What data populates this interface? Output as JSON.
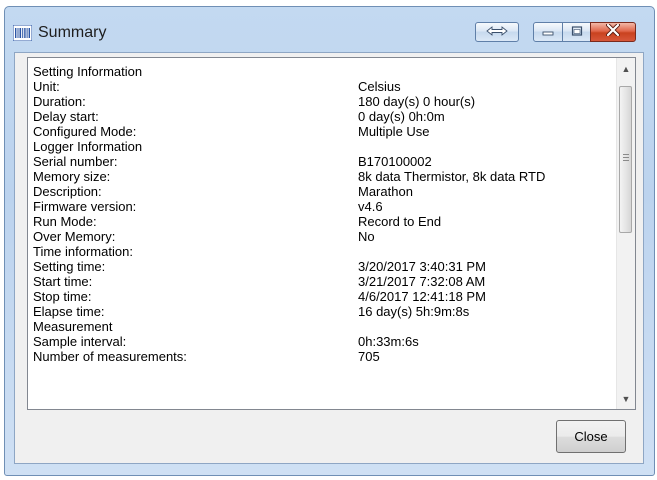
{
  "window": {
    "title": "Summary",
    "icons": {
      "app": "barcode-logger-icon",
      "resize": "horizontal-resize-icon",
      "minimize": "minimize-icon",
      "maximize": "maximize-icon",
      "close": "close-icon"
    },
    "colors": {
      "section_heading": "#1e3ec9",
      "close_button_red": "#c9421f"
    }
  },
  "summary": {
    "lines": [
      {
        "type": "section",
        "label": "Setting Information",
        "value": ""
      },
      {
        "type": "row",
        "label": "Unit:",
        "value": "Celsius"
      },
      {
        "type": "row",
        "label": "Duration:",
        "value": "180 day(s) 0 hour(s)"
      },
      {
        "type": "row",
        "label": "Delay start:",
        "value": "0 day(s) 0h:0m"
      },
      {
        "type": "row",
        "label": "Configured Mode:",
        "value": "Multiple Use"
      },
      {
        "type": "section",
        "label": "Logger Information",
        "value": ""
      },
      {
        "type": "row",
        "label": "Serial number:",
        "value": "B170100002"
      },
      {
        "type": "row",
        "label": "Memory size:",
        "value": "8k data Thermistor, 8k data RTD"
      },
      {
        "type": "row",
        "label": "Description:",
        "value": "Marathon"
      },
      {
        "type": "row",
        "label": "Firmware version:",
        "value": "v4.6"
      },
      {
        "type": "row",
        "label": "Run Mode:",
        "value": "Record to End"
      },
      {
        "type": "row",
        "label": "Over Memory:",
        "value": "No"
      },
      {
        "type": "section",
        "label": "Time information:",
        "value": ""
      },
      {
        "type": "row",
        "label": "Setting time:",
        "value": "3/20/2017 3:40:31 PM"
      },
      {
        "type": "row",
        "label": "Start time:",
        "value": "3/21/2017 7:32:08 AM"
      },
      {
        "type": "row",
        "label": "Stop time:",
        "value": "4/6/2017 12:41:18 PM"
      },
      {
        "type": "row",
        "label": "Elapse time:",
        "value": "16 day(s) 5h:9m:8s"
      },
      {
        "type": "section",
        "label": "Measurement",
        "value": ""
      },
      {
        "type": "row",
        "label": "Sample interval:",
        "value": "0h:33m:6s"
      },
      {
        "type": "row",
        "label": "Number of measurements:",
        "value": "705"
      }
    ],
    "scroll": {
      "thumb_position": 0.0,
      "visible_fraction": 0.55
    }
  },
  "footer": {
    "close_label": "Close"
  }
}
